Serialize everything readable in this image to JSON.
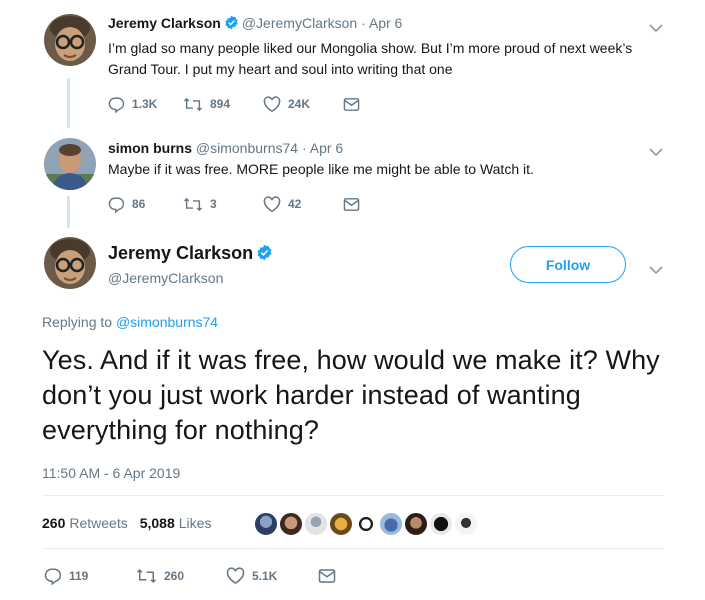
{
  "tweet1": {
    "name": "Jeremy Clarkson",
    "handle": "@JeremyClarkson",
    "time": "· Apr 6",
    "text": "I’m glad so many people liked our Mongolia show. But I’m more proud of next week’s Grand Tour. I put my heart and soul into writing that one",
    "replies": "1.3K",
    "retweets": "894",
    "likes": "24K"
  },
  "tweet2": {
    "name": "simon burns",
    "handle": "@simonburns74",
    "time": "· Apr 6",
    "text": "Maybe if it was free. MORE people like me might be able to Watch it.",
    "replies": "86",
    "retweets": "3",
    "likes": "42"
  },
  "main_tweet": {
    "name": "Jeremy Clarkson",
    "handle": "@JeremyClarkson",
    "follow_label": "Follow",
    "replying_prefix": "Replying to",
    "replying_to": "@simonburns74",
    "text": "Yes. And if it was free, how would we make it? Why don’t you just work harder instead of wanting everything for nothing?",
    "timestamp": "11:50 AM - 6 Apr 2019",
    "retweets_count": "260",
    "retweets_label": "Retweets",
    "likes_count": "5,088",
    "likes_label": "Likes",
    "replies": "119",
    "retweets": "260",
    "likes": "5.1K"
  },
  "colors": {
    "accent": "#1da1f2",
    "muted": "#657786",
    "thread_line": "#d2e4f2"
  },
  "icons": [
    "verified-badge-icon",
    "reply-icon",
    "retweet-icon",
    "like-icon",
    "direct-message-icon",
    "chevron-down-icon"
  ]
}
